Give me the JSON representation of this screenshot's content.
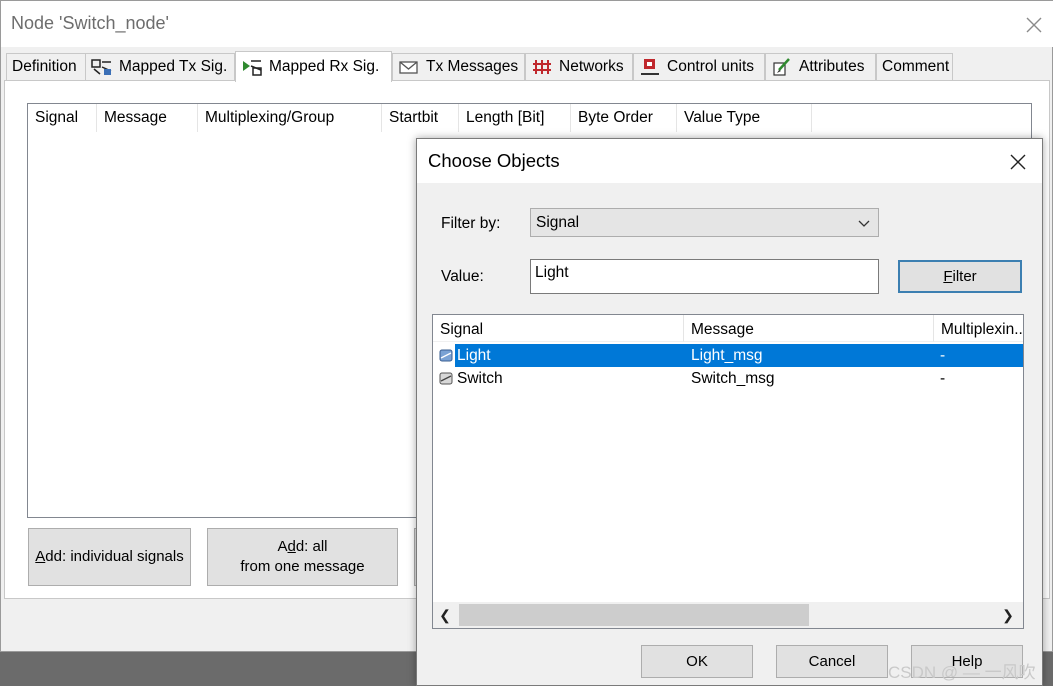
{
  "window": {
    "title": "Node 'Switch_node'",
    "tabs": [
      {
        "label": "Definition",
        "icon": "none"
      },
      {
        "label": "Mapped Tx Sig.",
        "icon": "mapped-tx-signals-icon"
      },
      {
        "label": "Mapped Rx Sig.",
        "icon": "mapped-rx-signals-icon",
        "active": true
      },
      {
        "label": "Tx Messages",
        "icon": "envelope-icon"
      },
      {
        "label": "Networks",
        "icon": "networks-icon"
      },
      {
        "label": "Control units",
        "icon": "control-units-icon"
      },
      {
        "label": "Attributes",
        "icon": "attributes-icon"
      },
      {
        "label": "Comment",
        "icon": "none"
      }
    ],
    "columns": [
      "Signal",
      "Message",
      "Multiplexing/Group",
      "Startbit",
      "Length [Bit]",
      "Byte Order",
      "Value Type"
    ],
    "buttons": {
      "add_individual_mnemonic": "A",
      "add_individual_rest": "dd: individual signals",
      "add_all_pre": "A",
      "add_all_mnemonic": "d",
      "add_all_post": "d: all",
      "add_all_line2": "from one message"
    }
  },
  "dialog": {
    "title": "Choose Objects",
    "filter_by_label": "Filter by:",
    "filter_by_value": "Signal",
    "value_label": "Value:",
    "value_text": "Light",
    "filter_button_mnemonic": "F",
    "filter_button_rest": "ilter",
    "columns": [
      "Signal",
      "Message",
      "Multiplexin..."
    ],
    "rows": [
      {
        "signal": "Light",
        "message": "Light_msg",
        "multiplexing": "-",
        "selected": true
      },
      {
        "signal": "Switch",
        "message": "Switch_msg",
        "multiplexing": "-",
        "selected": false
      }
    ],
    "ok": "OK",
    "cancel": "Cancel",
    "help": "Help"
  },
  "watermark": "CSDN @ — 一风吹",
  "colors": {
    "selection": "#0078d7",
    "accent_border": "#3c7fb1"
  }
}
